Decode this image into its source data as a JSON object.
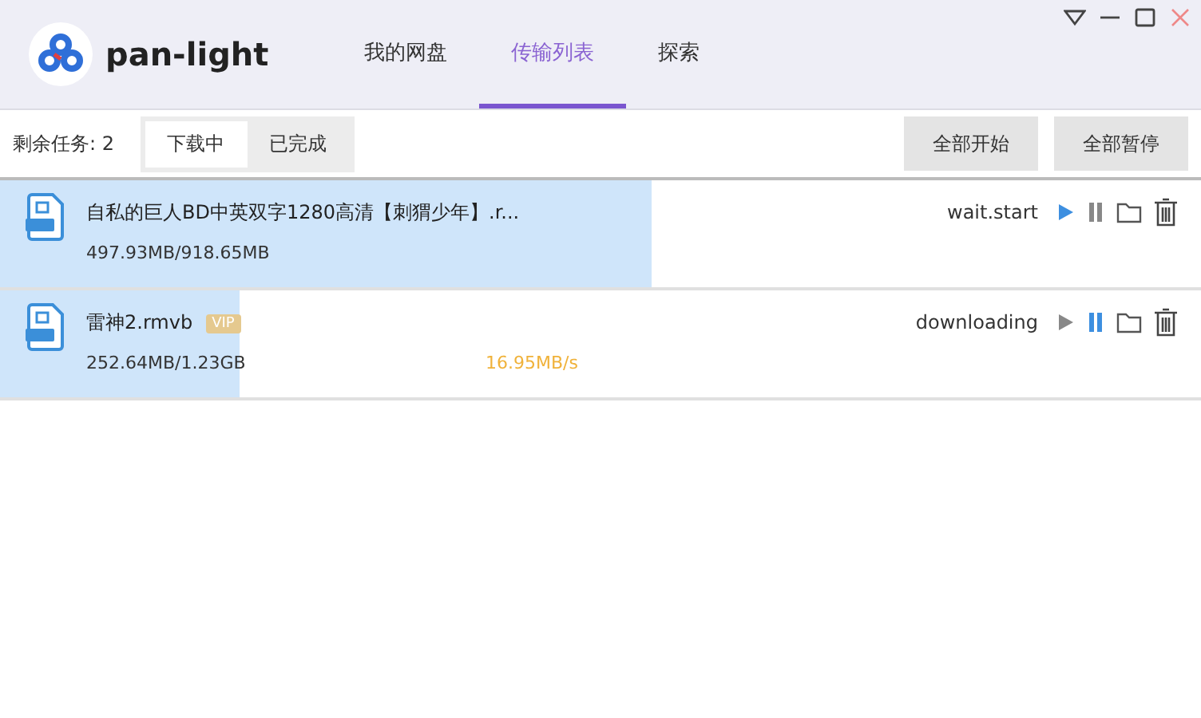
{
  "app": {
    "name": "pan-light"
  },
  "nav_tabs": [
    {
      "label": "我的网盘",
      "selected": false
    },
    {
      "label": "传输列表",
      "selected": true
    },
    {
      "label": "探索",
      "selected": false
    }
  ],
  "toolbar": {
    "remaining": "剩余任务: 2",
    "segments": [
      {
        "label": "下载中",
        "selected": true
      },
      {
        "label": "已完成",
        "selected": false
      }
    ],
    "buttons": [
      "全部开始",
      "全部暂停"
    ]
  },
  "downloads": [
    {
      "name": "自私的巨人BD中英双字1280高清【刺猬少年】.r...",
      "size": "497.93MB/918.65MB",
      "status": "wait.start",
      "play_active": true,
      "pause_active": false,
      "level": 0.542
    },
    {
      "name": "雷神2.rmvb",
      "badge": "VIP",
      "size": "252.64MB/1.23GB",
      "speed": "16.95MB/s",
      "status": "downloading",
      "play_active": false,
      "pause_active": true,
      "level": 0.2
    }
  ]
}
